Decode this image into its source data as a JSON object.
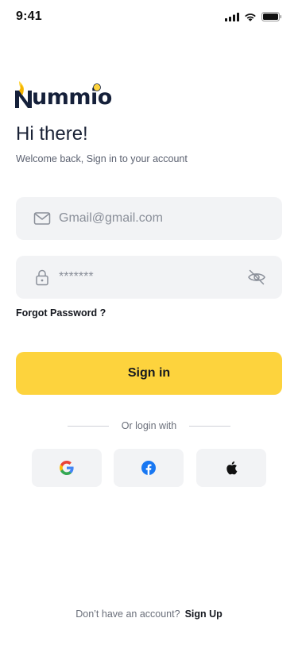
{
  "status_bar": {
    "time": "9:41"
  },
  "brand": {
    "name": "ummio",
    "accent_color": "#fdd33d",
    "text_color": "#15203a"
  },
  "header": {
    "title": "Hi there!",
    "subtitle": "Welcome back, Sign in to your account"
  },
  "form": {
    "email": {
      "placeholder": "Gmail@gmail.com",
      "value": ""
    },
    "password": {
      "value": "*******"
    },
    "forgot_label": "Forgot Password ?",
    "submit_label": "Sign in"
  },
  "social": {
    "divider_label": "Or login with",
    "providers": [
      "google",
      "facebook",
      "apple"
    ]
  },
  "footer": {
    "prompt": "Don’t have an account?",
    "signup_label": "Sign Up"
  },
  "colors": {
    "primary": "#fdd33d",
    "field_bg": "#f2f3f5"
  }
}
